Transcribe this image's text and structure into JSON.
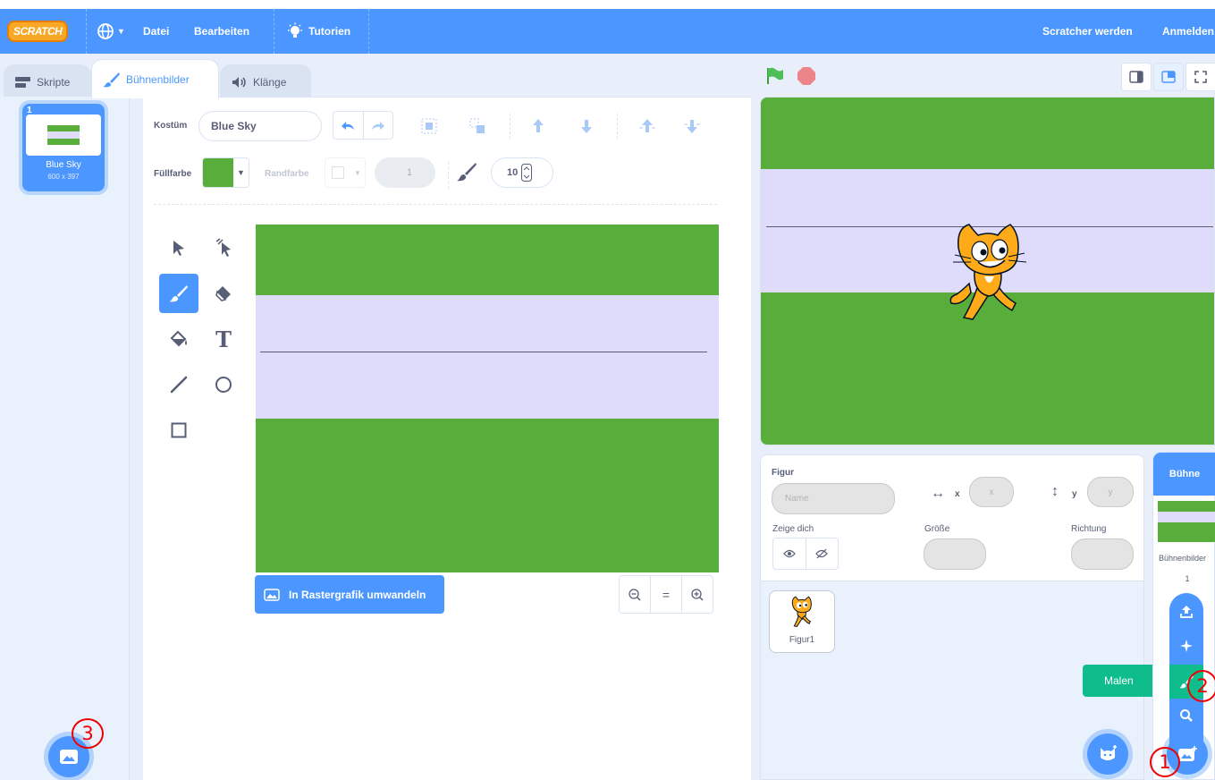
{
  "menubar": {
    "logo": "SCRATCH",
    "file": "Datei",
    "edit": "Bearbeiten",
    "tutorials": "Tutorien",
    "join": "Scratcher werden",
    "signin": "Anmelden"
  },
  "tabs": {
    "code": "Skripte",
    "costumes": "Bühnenbilder",
    "sounds": "Klänge"
  },
  "costume_list": [
    {
      "number": "1",
      "name": "Blue Sky",
      "size": "600 x 397"
    }
  ],
  "editor": {
    "costume_label": "Kostüm",
    "costume_name": "Blue Sky",
    "fill_label": "Füllfarbe",
    "outline_label": "Randfarbe",
    "outline_width": "1",
    "brush_size": "10",
    "convert_button": "In Rastergrafik umwandeln",
    "zoom_reset": "="
  },
  "sprite_info": {
    "sprite_label": "Figur",
    "name_placeholder": "Name",
    "x_label": "x",
    "x_placeholder": "x",
    "y_label": "y",
    "y_placeholder": "y",
    "show_label": "Zeige dich",
    "size_label": "Größe",
    "direction_label": "Richtung"
  },
  "sprites": [
    {
      "name": "Figur1"
    }
  ],
  "stage_panel": {
    "title": "Bühne",
    "backdrops_label": "Bühnenbilder",
    "backdrops_count": "1"
  },
  "tooltip": {
    "paint": "Malen"
  },
  "annotations": [
    "1",
    "2",
    "3"
  ],
  "colors": {
    "blue": "#4c97ff",
    "green": "#59ad3a",
    "lavender": "#dedcfa",
    "teal_tooltip": "#0fbd8c",
    "annotation_red": "#e00000"
  }
}
